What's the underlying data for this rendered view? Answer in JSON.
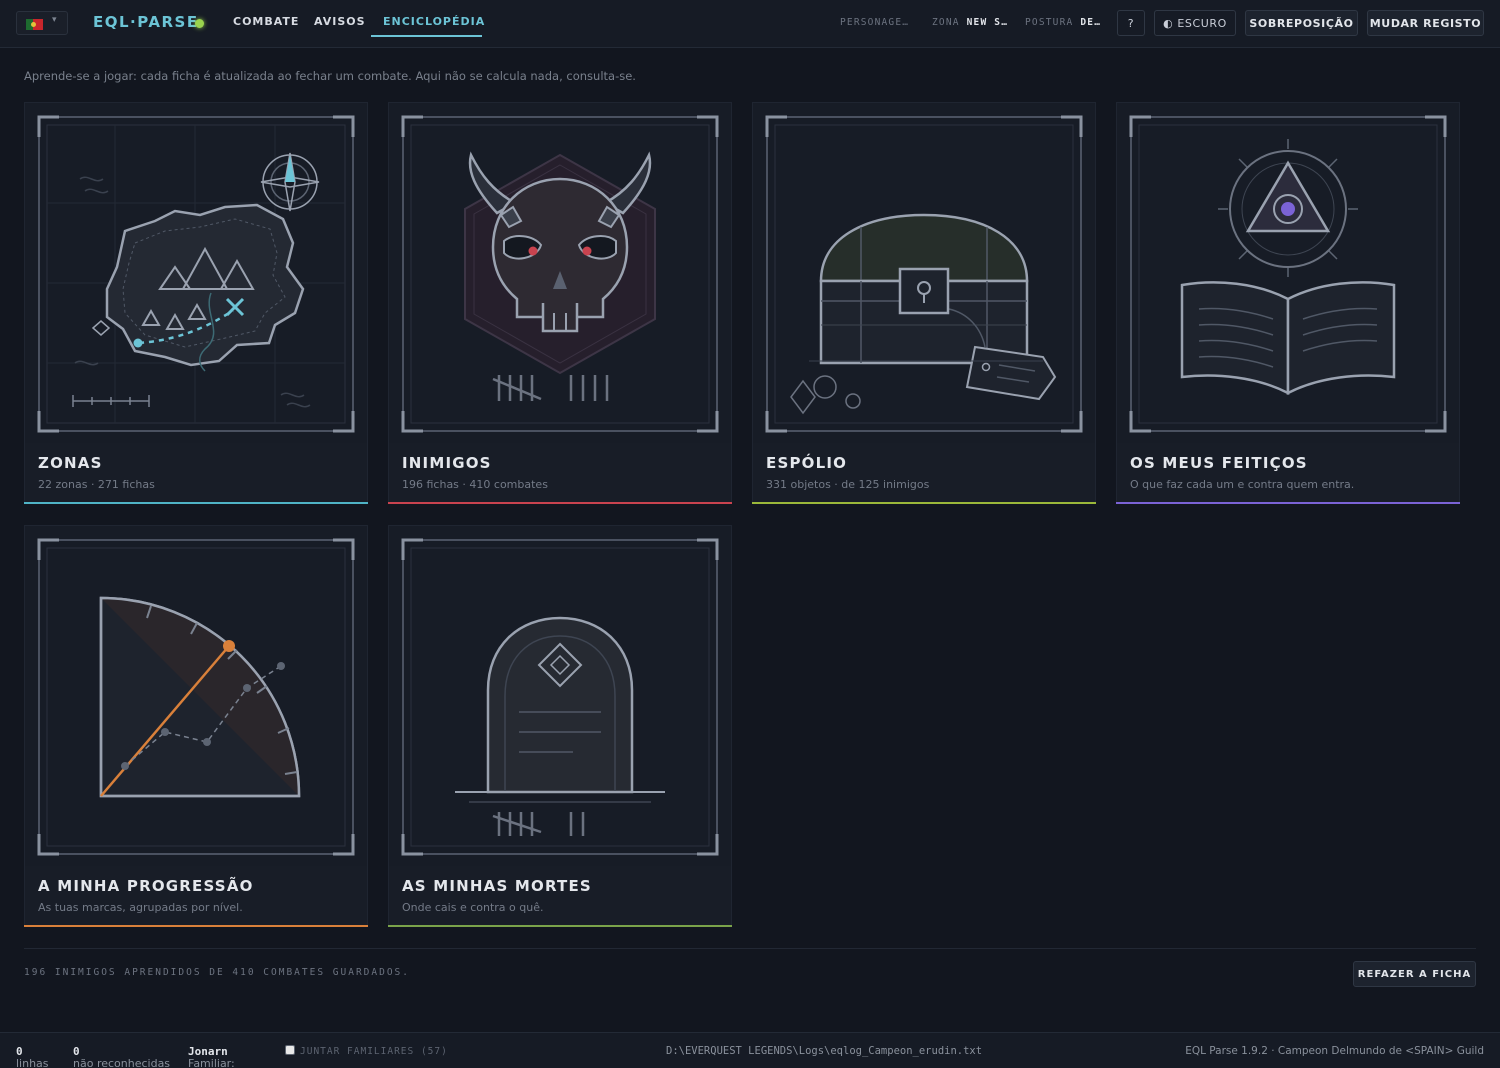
{
  "header": {
    "language_flag": "portugal-flag",
    "brand": "EQL·PARSE",
    "status_color": "#9ad34e",
    "tabs": [
      {
        "label": "COMBATE",
        "active": false
      },
      {
        "label": "AVISOS",
        "active": false
      },
      {
        "label": "ENCICLOPÉDIA",
        "active": true
      }
    ],
    "stats": {
      "character_label": "PERSONAGE…",
      "zone_label": "ZONA",
      "zone_value": "NEW S…",
      "posture_label": "POSTURA",
      "posture_value": "DE…"
    },
    "help_label": "?",
    "theme_label": "◐ ESCURO",
    "overlay_label": "SOBREPOSIÇÃO",
    "change_log_label": "MUDAR REGISTO"
  },
  "intro": "Aprende-se a jogar: cada ficha é atualizada ao fechar um combate. Aqui não se calcula nada, consulta-se.",
  "cards": [
    {
      "title": "ZONAS",
      "subtitle": "22 zonas · 271 fichas",
      "accent": "#4fb3c6",
      "icon": "map-icon"
    },
    {
      "title": "INIMIGOS",
      "subtitle": "196 fichas · 410 combates",
      "accent": "#c9434f",
      "icon": "skull-icon"
    },
    {
      "title": "ESPÓLIO",
      "subtitle": "331 objetos · de 125 inimigos",
      "accent": "#9bb83a",
      "icon": "treasure-chest-icon"
    },
    {
      "title": "OS MEUS FEITIÇOS",
      "subtitle": "O que faz cada um e contra quem entra.",
      "accent": "#7b63d6",
      "icon": "spellbook-icon"
    },
    {
      "title": "A MINHA PROGRESSÃO",
      "subtitle": "As tuas marcas, agrupadas por nível.",
      "accent": "#d9803a",
      "icon": "progress-gauge-icon"
    },
    {
      "title": "AS MINHAS MORTES",
      "subtitle": "Onde cais e contra o quê.",
      "accent": "#7aa34a",
      "icon": "tombstone-icon"
    }
  ],
  "summary": "196 INIMIGOS APRENDIDOS DE 410 COMBATES GUARDADOS.",
  "redo_label": "REFAZER A FICHA",
  "footer": {
    "lines_label": "linhas",
    "lines_value": "0",
    "unrecognized_label": "não reconhecidas",
    "unrecognized_value": "0",
    "familiar_label": "Familiar:",
    "familiar_value": "Jonarn",
    "join_familiars_label": "JUNTAR FAMILIARES (57)",
    "log_path": "D:\\EVERQUEST LEGENDS\\Logs\\eqlog_Campeon_erudin.txt",
    "version_info": "EQL Parse 1.9.2 · Campeon Delmundo de <SPAIN> Guild"
  }
}
